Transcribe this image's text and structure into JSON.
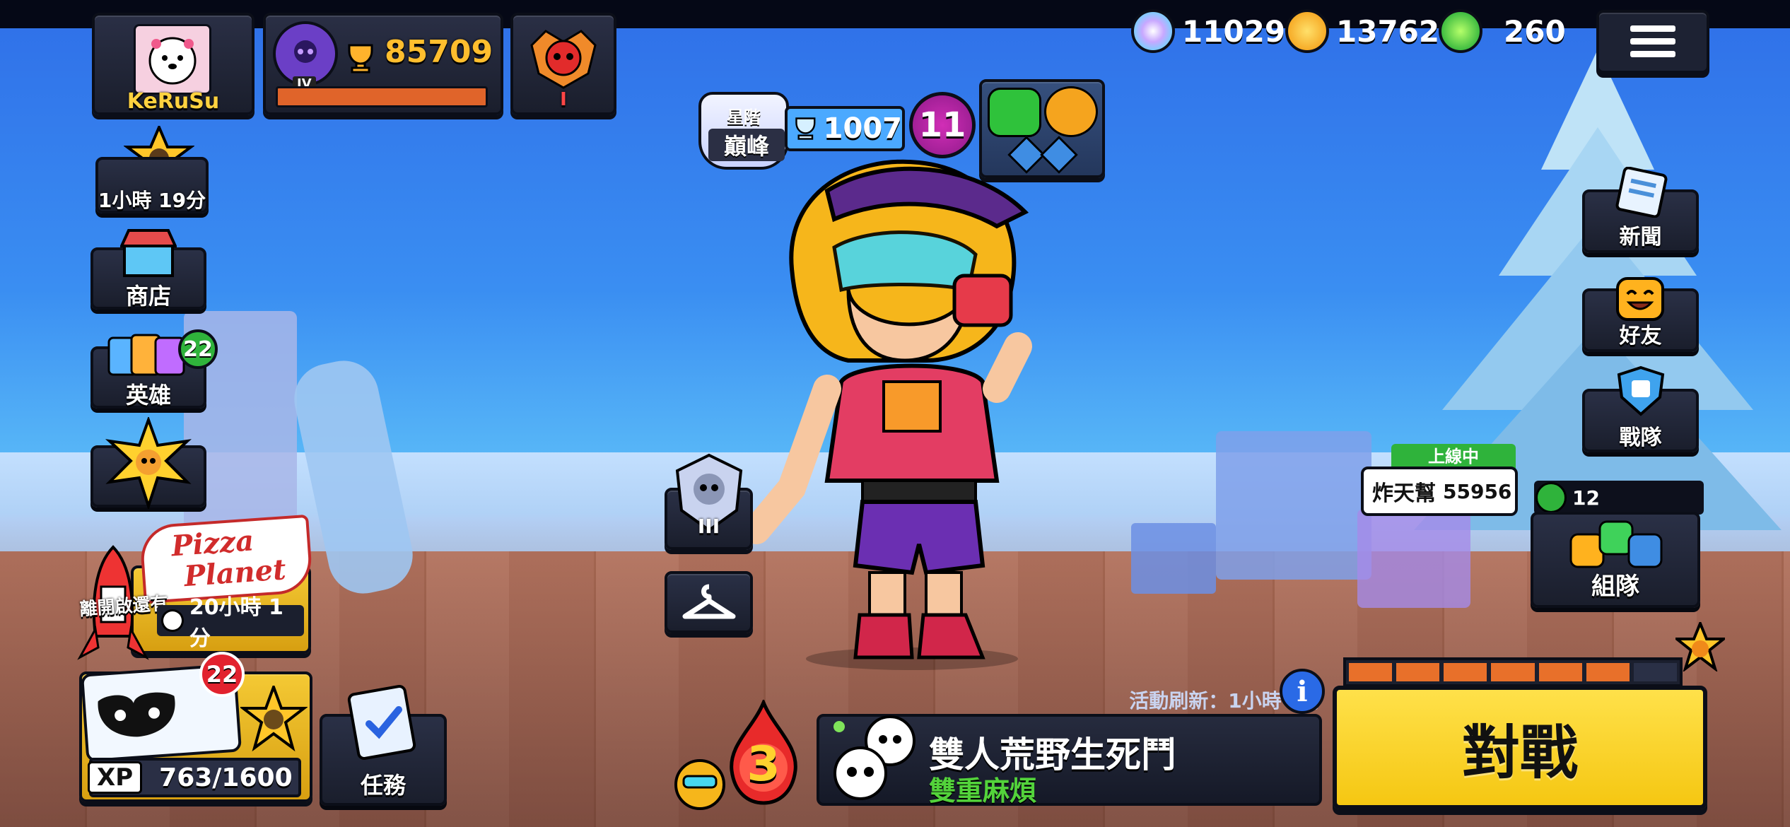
{
  "player": {
    "name": "KeRuSu",
    "trophies": "85709",
    "rank_roman": "IV",
    "ranked_roman": "I"
  },
  "currencies": {
    "credits": "11029",
    "coins": "13762",
    "gems": "260"
  },
  "brawler": {
    "tier_label_line1": "星階",
    "tier_label_line2": "巔峰",
    "trophies": "1007",
    "power_level": "11",
    "mastery_roman": "III"
  },
  "timers": {
    "starr_drop": "1小時 19分",
    "event": "20小時 1分",
    "refresh_prefix": "活動刷新：",
    "refresh_time": "1小時 1分"
  },
  "left_menu": {
    "shop": "商店",
    "brawlers": "英雄",
    "brawlers_badge": "22",
    "event_text": "離開啟還有",
    "pizza_line1": "Pizza",
    "pizza_line2": "Planet",
    "pass_badge": "22",
    "xp_label": "XP",
    "xp_value": "763/1600",
    "quests": "任務"
  },
  "right_menu": {
    "news": "新聞",
    "friends": "好友",
    "club": "戰隊",
    "team": "組隊",
    "online_status": "上線中",
    "friend_name": "炸天幫",
    "friend_trophies": "55956",
    "online_count": "12"
  },
  "game_mode": {
    "title": "雙人荒野生死鬥",
    "modifier": "雙重麻煩"
  },
  "drops": {
    "count": "3"
  },
  "play_button": "對戰",
  "colors": {
    "play": "#f5c712",
    "modifier_text": "#53d33b",
    "online_green": "#2fb33b"
  }
}
